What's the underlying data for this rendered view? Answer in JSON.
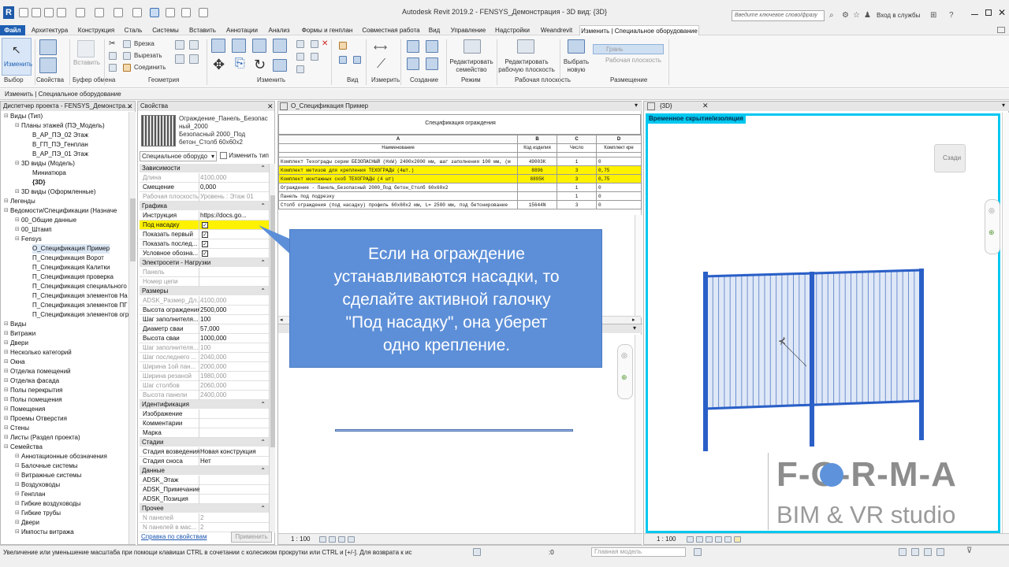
{
  "window": {
    "title": "Autodesk Revit 2019.2 - FENSYS_Демонстрация - 3D вид: {3D}",
    "search_placeholder": "Введите ключевое слово/фразу",
    "signin": "Вход в службы"
  },
  "menu": {
    "tabs": [
      "Файл",
      "Архитектура",
      "Конструкция",
      "Сталь",
      "Системы",
      "Вставить",
      "Аннотации",
      "Анализ",
      "Формы и генплан",
      "Совместная работа",
      "Вид",
      "Управление",
      "Надстройки",
      "Weandrevit",
      "Изменить | Специальное оборудование"
    ]
  },
  "ribbon": {
    "modify_label": "Изменить",
    "paste_label": "Вставить",
    "join_label": "Соединить",
    "cut_notch": "Врезка",
    "cut": "Вырезать",
    "edit_family": "Редактировать семейство",
    "edit_workplane": "Редактировать рабочую плоскость",
    "pick_new": "Выбрать новую",
    "face": "Грань",
    "work_plane": "Рабочая плоскость",
    "groups": [
      "Выбор",
      "Свойства",
      "Буфер обмена",
      "Геометрия",
      "Изменить",
      "Вид",
      "Измерить",
      "Создание",
      "Режим",
      "Рабочая плоскость",
      "Размещение"
    ]
  },
  "context": {
    "label": "Изменить | Специальное оборудование"
  },
  "browser": {
    "title": "Диспетчер проекта - FENSYS_Демонстра...",
    "items": [
      {
        "t": "Виды (Тип)",
        "l": 0
      },
      {
        "t": "Планы этажей (ПЭ_Модель)",
        "l": 1
      },
      {
        "t": "В_АР_ПЭ_02 Этаж",
        "l": 2
      },
      {
        "t": "В_ГП_ПЭ_Генплан",
        "l": 2
      },
      {
        "t": "В_АР_ПЭ_01 Этаж",
        "l": 2
      },
      {
        "t": "3D виды (Модель)",
        "l": 1
      },
      {
        "t": "Миниатюра",
        "l": 2
      },
      {
        "t": "{3D}",
        "l": 2,
        "b": true
      },
      {
        "t": "3D виды (Оформленные)",
        "l": 1
      },
      {
        "t": "Легенды",
        "l": 0
      },
      {
        "t": "Ведомости/Спецификации (Назначе",
        "l": 0
      },
      {
        "t": "00_Общие данные",
        "l": 1
      },
      {
        "t": "00_Штамп",
        "l": 1
      },
      {
        "t": "Fensys",
        "l": 1
      },
      {
        "t": "О_Спецификация Пример",
        "l": 2,
        "s": true
      },
      {
        "t": "П_Спецификация Ворот",
        "l": 2
      },
      {
        "t": "П_Спецификация Калитки",
        "l": 2
      },
      {
        "t": "П_Спецификация проверка",
        "l": 2
      },
      {
        "t": "П_Спецификация специального",
        "l": 2
      },
      {
        "t": "П_Спецификация элементов На",
        "l": 2
      },
      {
        "t": "П_Спецификация элементов ПГ",
        "l": 2
      },
      {
        "t": "П_Спецификация элементов огр",
        "l": 2
      },
      {
        "t": "Виды",
        "l": 0
      },
      {
        "t": "Витражи",
        "l": 0
      },
      {
        "t": "Двери",
        "l": 0
      },
      {
        "t": "Несколько категорий",
        "l": 0
      },
      {
        "t": "Окна",
        "l": 0
      },
      {
        "t": "Отделка помещений",
        "l": 0
      },
      {
        "t": "Отделка фасада",
        "l": 0
      },
      {
        "t": "Полы перекрытия",
        "l": 0
      },
      {
        "t": "Полы помещения",
        "l": 0
      },
      {
        "t": "Помещения",
        "l": 0
      },
      {
        "t": "Проемы Отверстия",
        "l": 0
      },
      {
        "t": "Стены",
        "l": 0
      },
      {
        "t": "Листы (Раздел проекта)",
        "l": 0
      },
      {
        "t": "Семейства",
        "l": 0
      },
      {
        "t": "Аннотационные обозначения",
        "l": 1
      },
      {
        "t": "Балочные системы",
        "l": 1
      },
      {
        "t": "Витражные системы",
        "l": 1
      },
      {
        "t": "Воздуховоды",
        "l": 1
      },
      {
        "t": "Генплан",
        "l": 1
      },
      {
        "t": "Гибкие воздуховоды",
        "l": 1
      },
      {
        "t": "Гибкие трубы",
        "l": 1
      },
      {
        "t": "Двери",
        "l": 1
      },
      {
        "t": "Импосты витража",
        "l": 1
      }
    ]
  },
  "properties": {
    "title": "Свойства",
    "type_name": "Ограждение_Панель_Безопасный_2000 Безопасный 2000_Под бетон_Столб 60х60х2",
    "type_lines": [
      "Ограждение_Панель_Безопас",
      "ный_2000",
      "Безопасный 2000_Под",
      "бетон_Столб 60х60х2"
    ],
    "selector": "Специальное оборудо",
    "edit_type": "Изменить тип",
    "help_link": "Справка по свойствам",
    "apply": "Применить",
    "rows": [
      {
        "c": "Зависимости"
      },
      {
        "k": "Длина",
        "v": "4100,000",
        "d": true
      },
      {
        "k": "Смещение",
        "v": "0,000"
      },
      {
        "k": "Рабочая плоскость",
        "v": "Уровень : Этаж 01",
        "d": true
      },
      {
        "c": "Графика"
      },
      {
        "k": "Инструкция",
        "v": "https://docs.go..."
      },
      {
        "k": "Под насадку",
        "chk": true,
        "hl": true
      },
      {
        "k": "Показать первый",
        "chk": true
      },
      {
        "k": "Показать послед...",
        "chk": true
      },
      {
        "k": "Условное обозна...",
        "chk": true
      },
      {
        "c": "Электросети - Нагрузки"
      },
      {
        "k": "Панель",
        "v": "",
        "d": true
      },
      {
        "k": "Номер цепи",
        "v": "",
        "d": true
      },
      {
        "c": "Размеры"
      },
      {
        "k": "ADSK_Размер_Дл...",
        "v": "4100,000",
        "d": true
      },
      {
        "k": "Высота ограждения",
        "v": "2500,000"
      },
      {
        "k": "Шаг заполнителя...",
        "v": "100"
      },
      {
        "k": "Диаметр сваи",
        "v": "57,000"
      },
      {
        "k": "Высота сваи",
        "v": "1000,000"
      },
      {
        "k": "Шаг заполнителя...",
        "v": "100",
        "d": true
      },
      {
        "k": "Шаг последнего ...",
        "v": "2040,000",
        "d": true
      },
      {
        "k": "Ширина 1ой пан...",
        "v": "2000,000",
        "d": true
      },
      {
        "k": "Ширина резаной",
        "v": "1980,000",
        "d": true
      },
      {
        "k": "Шаг столбов",
        "v": "2060,000",
        "d": true
      },
      {
        "k": "Высота панели",
        "v": "2400,000",
        "d": true
      },
      {
        "c": "Идентификация"
      },
      {
        "k": "Изображение",
        "v": ""
      },
      {
        "k": "Комментарии",
        "v": ""
      },
      {
        "k": "Марка",
        "v": ""
      },
      {
        "c": "Стадии"
      },
      {
        "k": "Стадия возведения",
        "v": "Новая конструкция"
      },
      {
        "k": "Стадия сноса",
        "v": "Нет"
      },
      {
        "c": "Данные"
      },
      {
        "k": "ADSK_Этаж",
        "v": ""
      },
      {
        "k": "ADSK_Примечание",
        "v": ""
      },
      {
        "k": "ADSK_Позиция",
        "v": ""
      },
      {
        "c": "Прочее"
      },
      {
        "k": "N панелей",
        "v": "2",
        "d": true
      },
      {
        "k": "N панелей в мас...",
        "v": "2",
        "d": true
      }
    ]
  },
  "schedule": {
    "tab": "О_Спецификация Пример",
    "title": "Спецификация ограждения",
    "col_letters": [
      "A",
      "B",
      "C",
      "D"
    ],
    "headers": [
      "Наименование",
      "Код изделия",
      "Число",
      "Комплект кре"
    ],
    "rows": [
      {
        "c": [
          "Комплект Техограды серии БЕЗОПАСНЫЙ (НхW) 2400х2000 мм, шаг заполнения 100 мм, (м",
          "49003К",
          "1",
          "0"
        ]
      },
      {
        "c": [
          "Комплект метизов для крепления ТЕХОГРАДЫ (4шт.)",
          "8896",
          "3",
          "0,75"
        ],
        "hl": true
      },
      {
        "c": [
          "Комплект монтажных скоб ТЕХОГРАДЫ (4 шт)",
          "8895К",
          "3",
          "0,75"
        ],
        "hl": true
      },
      {
        "c": [
          "Ограждение - Панель_Безопасный 2000_Под бетон_Столб 60х60х2",
          "",
          "1",
          "0"
        ]
      },
      {
        "c": [
          "Панель под подрезку",
          "",
          "1",
          "0"
        ]
      },
      {
        "c": [
          "Столб ограждения (под насадку) профиль 60х60х2 мм, L= 2500 мм, под бетонирование",
          "15644N",
          "3",
          "0"
        ]
      }
    ],
    "scale": "1 : 100"
  },
  "view3d": {
    "tab": "{3D}",
    "banner": "Временное скрытие/изоляция",
    "cube": "Сзади",
    "scale": "1 : 100"
  },
  "callout": {
    "lines": [
      "Если на ограждение",
      "устанавливаются насадки, то",
      "сделайте активной галочку",
      "\"Под насадку\", она уберет",
      "одно крепление."
    ]
  },
  "watermark": {
    "forma": "F-O-R-M-A",
    "bim": "BIM & VR studio"
  },
  "status": {
    "hint": "Увеличение или уменьшение масштаба при помощи клавиши CTRL в сочетании с колесиком прокрутки или CTRL и [+/-]. Для возврата к ис",
    "zero": ":0",
    "model": "Главная модель"
  },
  "colors": {
    "accent": "#1e5fb3",
    "highlight": "#fff200",
    "callout": "#5d8fd8",
    "isolation": "#00c8f0",
    "fence": "#2a5fc7"
  }
}
